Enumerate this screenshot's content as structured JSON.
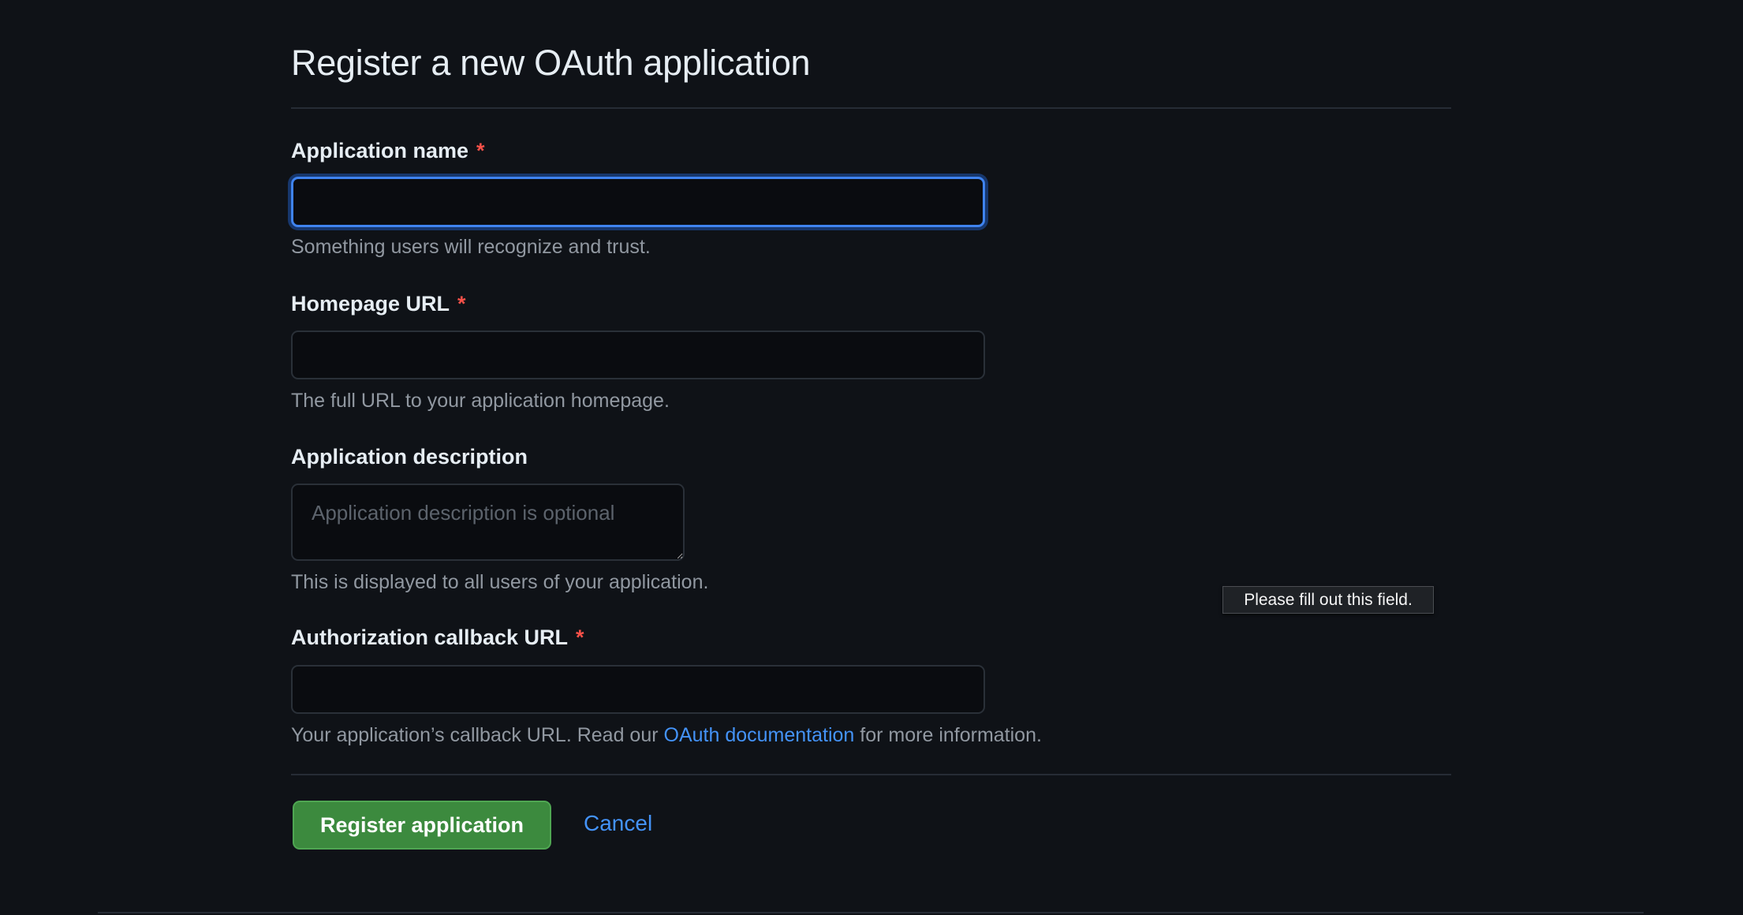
{
  "page": {
    "title": "Register a new OAuth application"
  },
  "form": {
    "app_name": {
      "label": "Application name",
      "required_mark": "*",
      "value": "",
      "hint": "Something users will recognize and trust."
    },
    "homepage_url": {
      "label": "Homepage URL",
      "required_mark": "*",
      "value": "",
      "hint": "The full URL to your application homepage."
    },
    "description": {
      "label": "Application description",
      "placeholder": "Application description is optional",
      "hint": "This is displayed to all users of your application."
    },
    "callback_url": {
      "label": "Authorization callback URL",
      "required_mark": "*",
      "value": "",
      "hint_before": "Your application’s callback URL. Read our",
      "hint_link": "OAuth documentation",
      "hint_after": "for more information."
    }
  },
  "validation_tooltip": "Please fill out this field.",
  "actions": {
    "register_label": "Register application",
    "cancel_label": "Cancel"
  },
  "colors": {
    "background": "#0f1217",
    "accent": "#4493f8",
    "primary_button": "#3c8a3e",
    "required": "#f85149",
    "focus_ring": "#3f83ef"
  }
}
